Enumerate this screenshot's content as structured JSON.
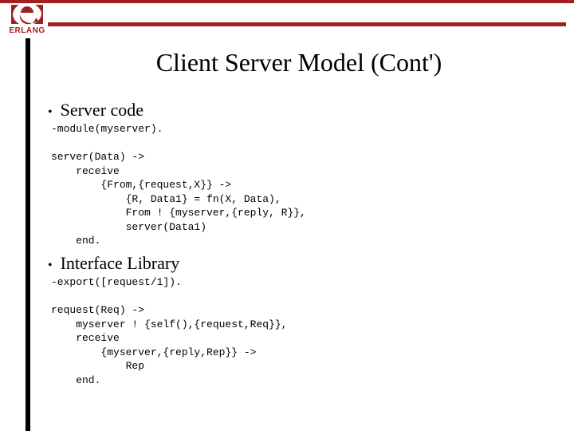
{
  "brand": {
    "name": "ERLANG",
    "accent": "#a11f1f"
  },
  "slide": {
    "title": "Client Server Model (Cont')",
    "sections": [
      {
        "bullet": "Server code",
        "code": "-module(myserver).\n\nserver(Data) ->\n    receive\n        {From,{request,X}} ->\n            {R, Data1} = fn(X, Data),\n            From ! {myserver,{reply, R}},\n            server(Data1)\n    end."
      },
      {
        "bullet": "Interface Library",
        "code": "-export([request/1]).\n\nrequest(Req) ->\n    myserver ! {self(),{request,Req}},\n    receive\n        {myserver,{reply,Rep}} ->\n            Rep\n    end."
      }
    ]
  }
}
